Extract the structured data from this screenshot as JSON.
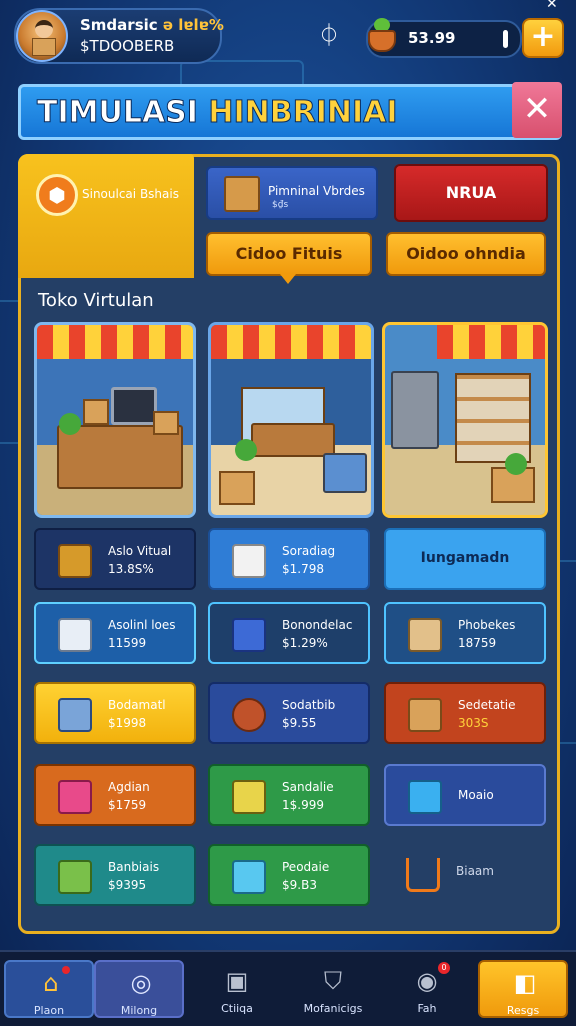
{
  "header": {
    "profile_name": "Smdarsic",
    "profile_highlight": "ə lɐlɐ%",
    "profile_money": "$TDOOBERB",
    "coin_value": "53.99",
    "plus_label": "+",
    "corner_close": "✕"
  },
  "title": {
    "part1": "TIMULASI ",
    "part2": "HINBRINIAI",
    "close_label": "✕"
  },
  "tabs": {
    "active_label": "Sinoulcai Bshais",
    "active_icon": "⬢",
    "blue_label": "Pimninal Vbrdes",
    "blue_sub": "$₫s",
    "red_label": "NRUA",
    "orange1_label": "Cidoo Fituis",
    "orange2_label": "Oidoo ohndia"
  },
  "section": {
    "title": "Toko Virtulan"
  },
  "items": [
    {
      "name": "Aslo Vitual",
      "price": "13.8S%"
    },
    {
      "name": "Soradiag",
      "price": "$1.798"
    },
    {
      "name": "Iungamadn",
      "price": ""
    },
    {
      "name": "Asolinl loes",
      "price": "11599"
    },
    {
      "name": "Bonondelac",
      "price": "$1.29%"
    },
    {
      "name": "Phobekes",
      "price": "18759"
    },
    {
      "name": "Bodamatl",
      "price": "$1998"
    },
    {
      "name": "Sodatbib",
      "price": "$9.55"
    },
    {
      "name": "Sedetatie",
      "price": "303S"
    },
    {
      "name": "Agdian",
      "price": "$1759"
    },
    {
      "name": "Sandalie",
      "price": "1$.999"
    },
    {
      "name": "Moaio",
      "price": ""
    },
    {
      "name": "Banbiais",
      "price": "$9395"
    },
    {
      "name": "Peodaie",
      "price": "$9.B3"
    },
    {
      "name": "Biaam",
      "price": ""
    }
  ],
  "nav": [
    {
      "label": "Plaon",
      "icon": "home-icon"
    },
    {
      "label": "Milong",
      "icon": "target-icon"
    },
    {
      "label": "Ctiiqa",
      "icon": "box-icon"
    },
    {
      "label": "Mofanicigs",
      "icon": "shield-icon"
    },
    {
      "label": "Fah",
      "icon": "compass-icon",
      "badge": "0"
    },
    {
      "label": "Resgs",
      "icon": "cube-icon"
    }
  ]
}
